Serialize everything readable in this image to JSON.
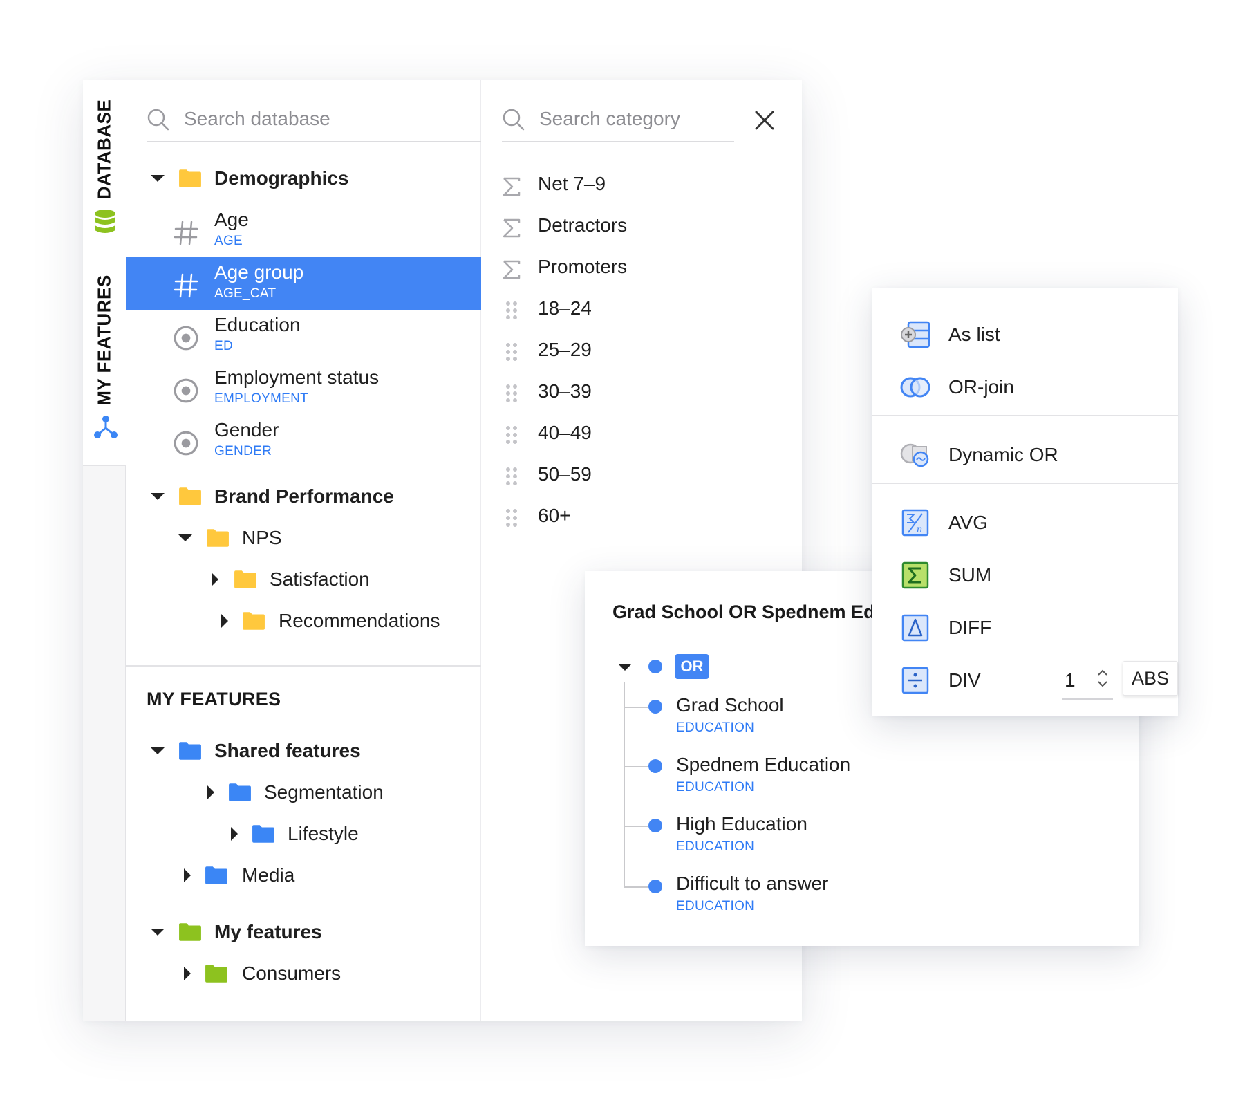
{
  "rail": {
    "database_tab": "DATABASE",
    "my_features_tab": "MY FEATURES",
    "database_icon": "database-icon",
    "features_icon": "network-icon"
  },
  "tree": {
    "search_placeholder": "Search database",
    "demographics": {
      "label": "Demographics",
      "fields": [
        {
          "name": "Age",
          "code": "AGE",
          "icon": "hash-icon"
        },
        {
          "name": "Age group",
          "code": "AGE_CAT",
          "icon": "hash-icon",
          "selected": true
        },
        {
          "name": "Education",
          "code": "ED",
          "icon": "radio-icon"
        },
        {
          "name": "Employment status",
          "code": "EMPLOYMENT",
          "icon": "radio-icon"
        },
        {
          "name": "Gender",
          "code": "GENDER",
          "icon": "radio-icon"
        }
      ]
    },
    "brand_performance": {
      "label": "Brand Performance",
      "nps": "NPS",
      "satisfaction": "Satisfaction",
      "recommendations": "Recommendations"
    },
    "my_features_heading": "MY FEATURES",
    "shared_features": "Shared features",
    "segmentation": "Segmentation",
    "lifestyle": "Lifestyle",
    "media": "Media",
    "my_features": "My features",
    "consumers": "Consumers"
  },
  "category": {
    "search_placeholder": "Search category",
    "items": [
      {
        "label": "Net 7–9",
        "icon": "sigma-icon"
      },
      {
        "label": "Detractors",
        "icon": "sigma-icon"
      },
      {
        "label": "Promoters",
        "icon": "sigma-icon"
      },
      {
        "label": "18–24",
        "icon": "drag-handle-icon"
      },
      {
        "label": "25–29",
        "icon": "drag-handle-icon"
      },
      {
        "label": "30–39",
        "icon": "drag-handle-icon"
      },
      {
        "label": "40–49",
        "icon": "drag-handle-icon"
      },
      {
        "label": "50–59",
        "icon": "drag-handle-icon"
      },
      {
        "label": "60+",
        "icon": "drag-handle-icon"
      }
    ]
  },
  "expression": {
    "title": "Grad School OR Spednem Edu",
    "operator": "OR",
    "items": [
      {
        "name": "Grad School",
        "code": "EDUCATION"
      },
      {
        "name": "Spednem Education",
        "code": "EDUCATION"
      },
      {
        "name": "High Education",
        "code": "EDUCATION"
      },
      {
        "name": "Difficult to answer",
        "code": "EDUCATION"
      }
    ]
  },
  "operators": {
    "as_list": "As list",
    "or_join": "OR-join",
    "dynamic_or": "Dynamic OR",
    "avg": "AVG",
    "sum": "SUM",
    "diff": "DIFF",
    "div": "DIV",
    "div_value": "1",
    "abs": "ABS"
  },
  "colors": {
    "accent": "#4285f4",
    "code_text": "#2f7bf5",
    "folder_yellow": "#ffc83d",
    "folder_blue": "#3b86f5",
    "folder_green": "#8dc21f",
    "db_green": "#8dc21f"
  }
}
